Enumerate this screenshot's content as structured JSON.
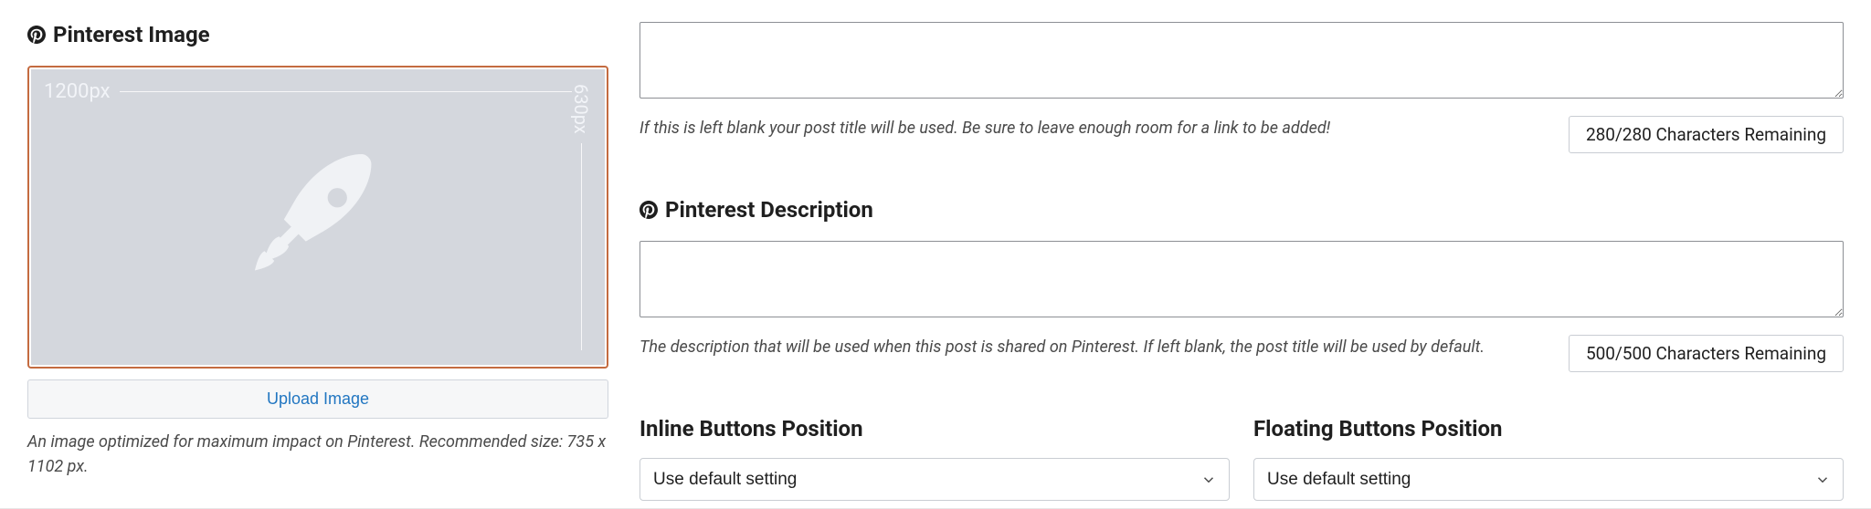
{
  "pinterest_image": {
    "heading": "Pinterest Image",
    "width_label": "1200px",
    "height_label": "630px",
    "upload_button": "Upload Image",
    "help": "An image optimized for maximum impact on Pinterest. Recommended size: 735 x 1102 px."
  },
  "title_field": {
    "value": "",
    "help": "If this is left blank your post title will be used. Be sure to leave enough room for a link to be added!",
    "char_count": "280/280 Characters Remaining"
  },
  "pinterest_description": {
    "heading": "Pinterest Description",
    "value": "",
    "help": "The description that will be used when this post is shared on Pinterest. If left blank, the post title will be used by default.",
    "char_count": "500/500 Characters Remaining"
  },
  "inline_buttons": {
    "heading": "Inline Buttons Position",
    "selected": "Use default setting"
  },
  "floating_buttons": {
    "heading": "Floating Buttons Position",
    "selected": "Use default setting"
  }
}
